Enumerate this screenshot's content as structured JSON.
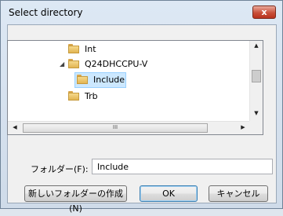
{
  "window": {
    "title": "Select directory",
    "close_label": "x"
  },
  "tree": {
    "items": [
      {
        "label": "Int",
        "expander": ""
      },
      {
        "label": "Q24DHCCPU-V",
        "expander": "◢"
      },
      {
        "label": "Include",
        "expander": "",
        "selected": true
      },
      {
        "label": "Trb",
        "expander": ""
      }
    ],
    "scroll": {
      "up": "▲",
      "down": "▼",
      "left": "◀",
      "right": "▶",
      "grip": "III"
    }
  },
  "folder_field": {
    "label": "フォルダー(F):",
    "value": "Include"
  },
  "buttons": {
    "new_folder": "新しいフォルダーの作成(N)",
    "ok": "OK",
    "cancel": "キャンセル"
  },
  "colors": {
    "selection": "#cce8ff",
    "close": "#c9503a"
  }
}
